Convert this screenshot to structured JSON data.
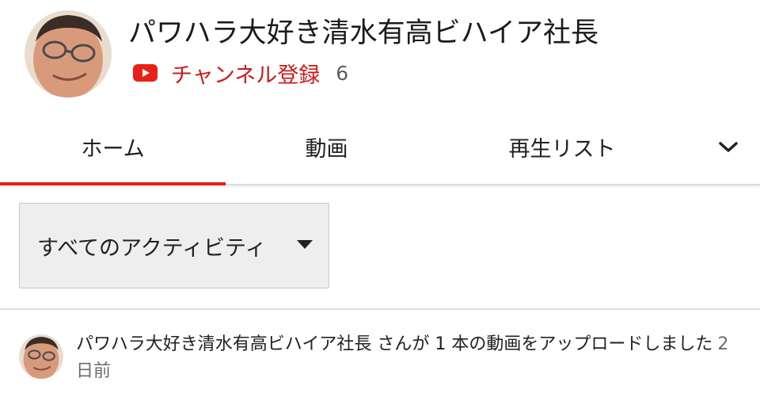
{
  "channel": {
    "name": "パワハラ大好き清水有高ビハイア社長",
    "subscribe_label": "チャンネル登録",
    "subscriber_count": "6",
    "brand_color": "#e62117"
  },
  "tabs": [
    {
      "label": "ホーム",
      "active": true
    },
    {
      "label": "動画",
      "active": false
    },
    {
      "label": "再生リスト",
      "active": false
    }
  ],
  "tab_more_icon": "chevron-down-icon",
  "filter": {
    "selected": "すべてのアクティビティ"
  },
  "activity": {
    "text": "パワハラ大好き清水有高ビハイア社長 さんが 1 本の動画をアップロードしました",
    "time": "2 日前"
  }
}
